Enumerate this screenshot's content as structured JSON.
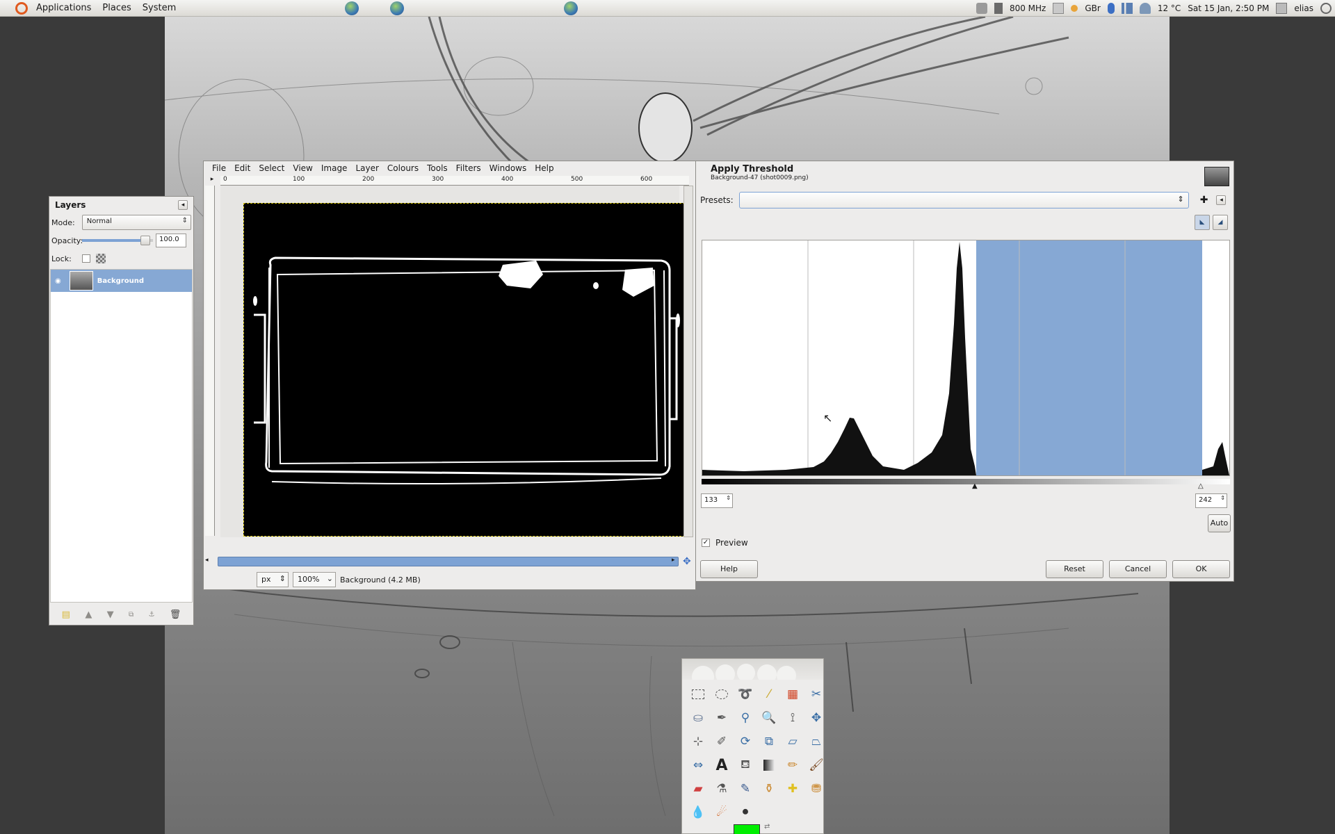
{
  "top_panel": {
    "menus": [
      "Applications",
      "Places",
      "System"
    ],
    "cpu_freq": "800 MHz",
    "keyboard": "GBr",
    "temperature": "12 °C",
    "datetime": "Sat 15 Jan,  2:50 PM",
    "user": "elias"
  },
  "layers_dock": {
    "title": "Layers",
    "mode_label": "Mode:",
    "mode_value": "Normal",
    "opacity_label": "Opacity:",
    "opacity_value": "100.0",
    "lock_label": "Lock:",
    "layer_name": "Background"
  },
  "image_window": {
    "menus": [
      "File",
      "Edit",
      "Select",
      "View",
      "Image",
      "Layer",
      "Colours",
      "Tools",
      "Filters",
      "Windows",
      "Help"
    ],
    "ruler_ticks": [
      "0",
      "100",
      "200",
      "300",
      "400",
      "500",
      "600"
    ],
    "unit": "px",
    "zoom": "100%",
    "status": "Background (4.2 MB)"
  },
  "threshold_dialog": {
    "title": "Apply Threshold",
    "subtitle": "Background-47 (shot0009.png)",
    "presets_label": "Presets:",
    "presets_value": "",
    "low_value": "133",
    "high_value": "242",
    "auto_label": "Auto",
    "preview_label": "Preview",
    "preview_checked": true,
    "help_label": "Help",
    "reset_label": "Reset",
    "cancel_label": "Cancel",
    "ok_label": "OK",
    "selection_color": "#86a8d4"
  },
  "toolbox": {
    "tools": [
      "rect-select",
      "ellipse-select",
      "free-select",
      "fuzzy-select",
      "select-by-color",
      "scissors",
      "foreground-select",
      "paths",
      "color-picker",
      "zoom",
      "measure",
      "move",
      "align",
      "crop",
      "rotate",
      "scale",
      "shear",
      "perspective",
      "flip",
      "text",
      "bucket-fill",
      "blend",
      "pencil",
      "paintbrush",
      "eraser",
      "airbrush",
      "ink",
      "clone",
      "heal",
      "perspective-clone",
      "blur",
      "smudge",
      "dodge-burn"
    ],
    "foreground_color": "#00ee00"
  }
}
